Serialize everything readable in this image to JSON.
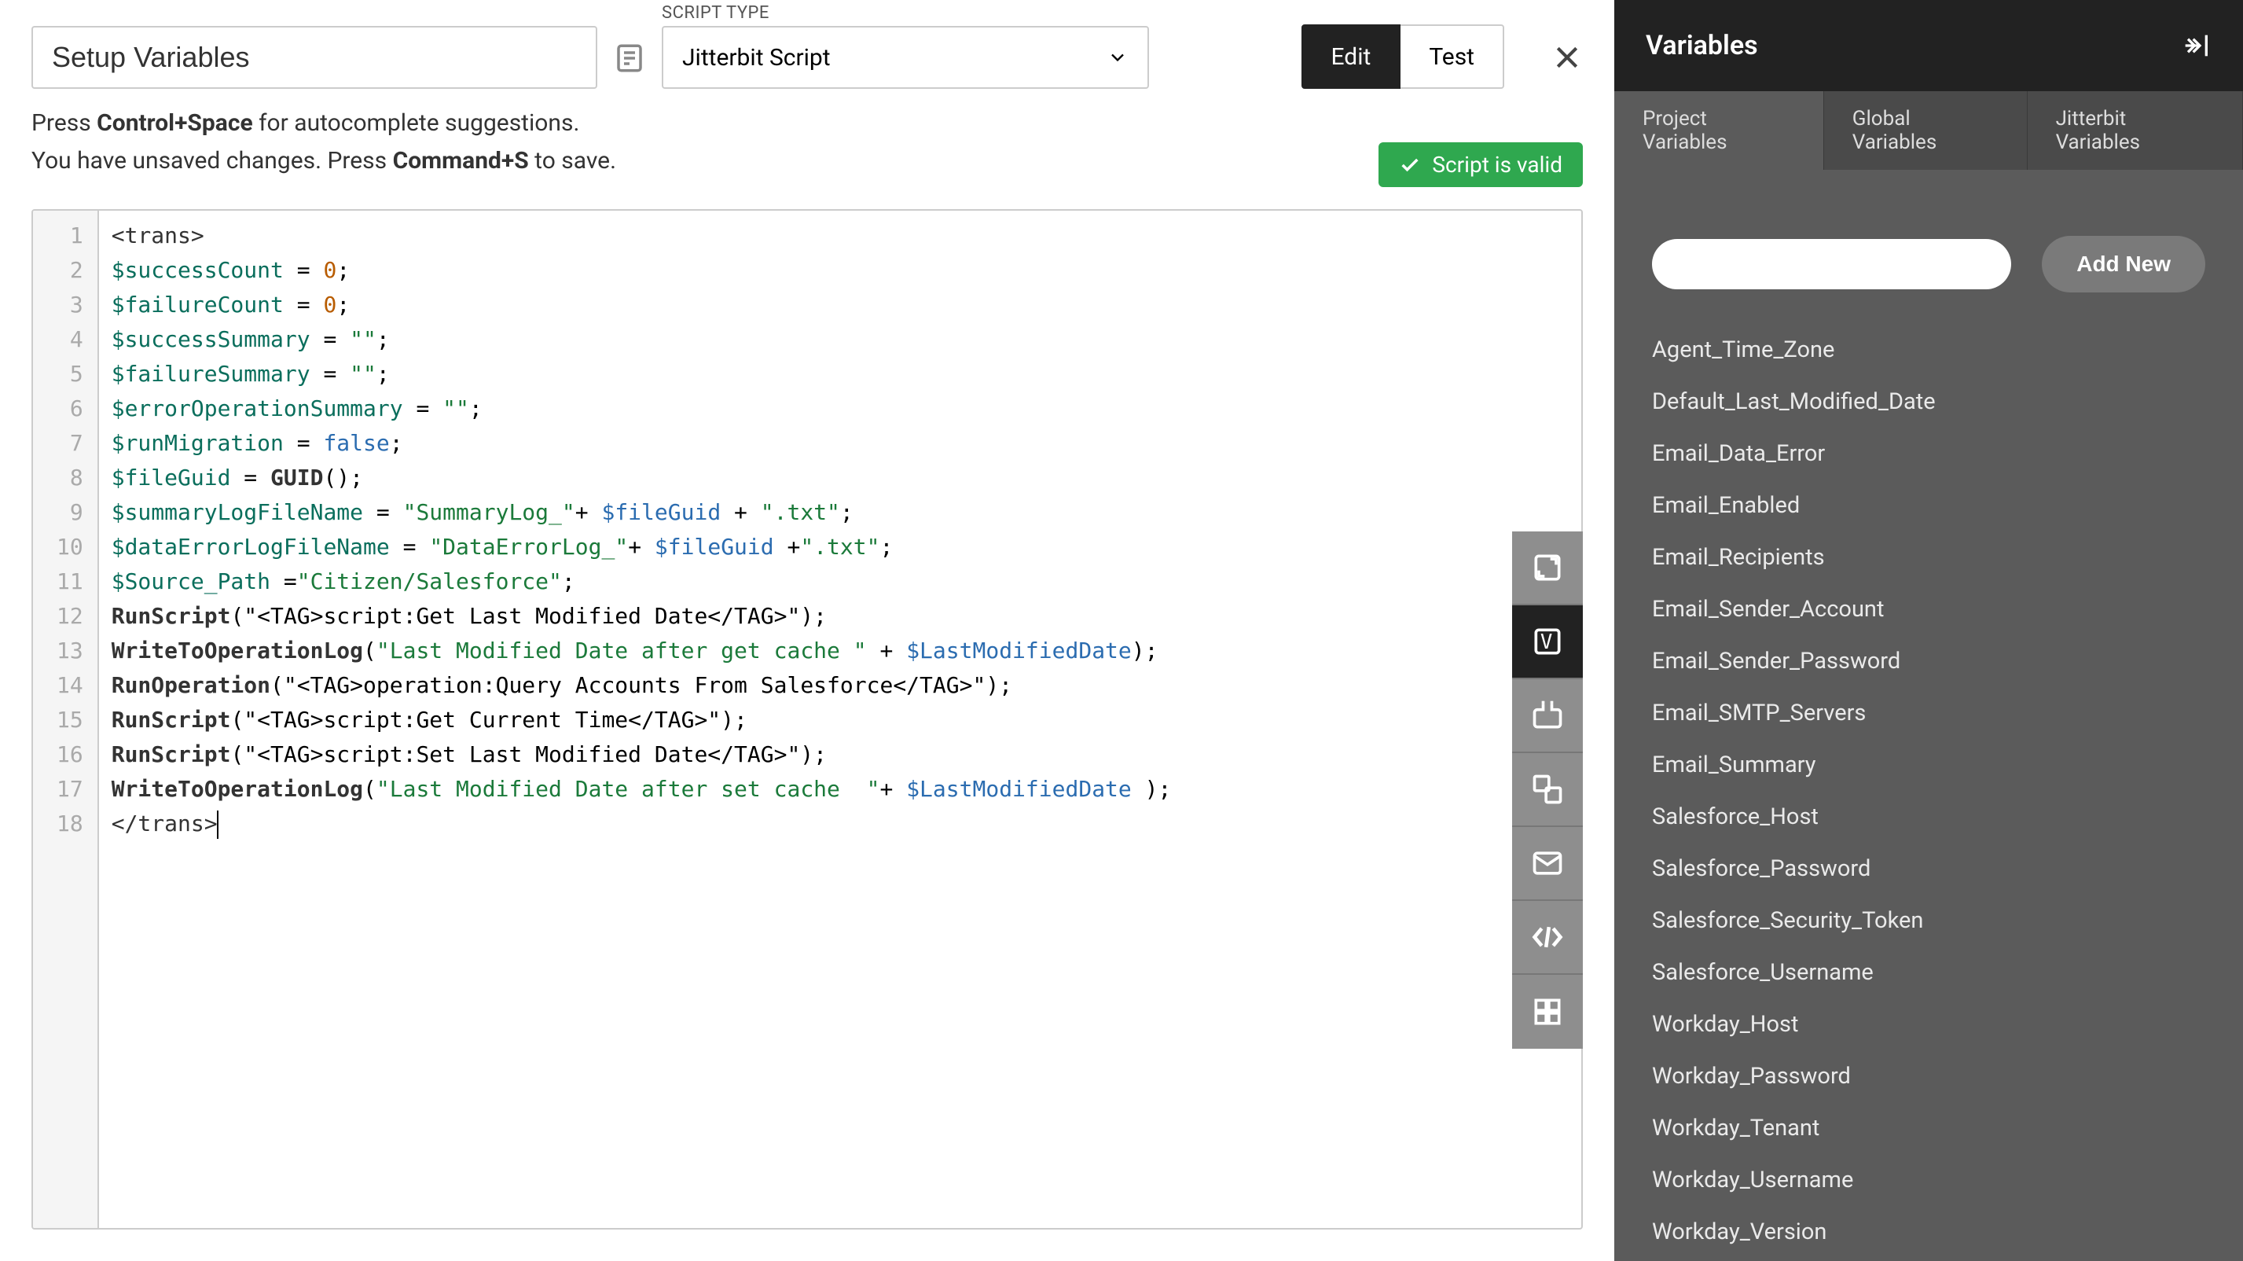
{
  "scriptName": "Setup Variables",
  "scriptTypeLabel": "SCRIPT TYPE",
  "scriptType": "Jitterbit Script",
  "editBtn": "Edit",
  "testBtn": "Test",
  "hint1_prefix": "Press ",
  "hint1_key": "Control+Space",
  "hint1_suffix": " for autocomplete suggestions.",
  "hint2_prefix": "You have unsaved changes. Press ",
  "hint2_key": "Command+S",
  "hint2_suffix": " to save.",
  "validBadge": "Script is valid",
  "code": {
    "lines": [
      "<trans>",
      "$successCount = 0;",
      "$failureCount = 0;",
      "$successSummary = \"\";",
      "$failureSummary = \"\";",
      "$errorOperationSummary = \"\";",
      "$runMigration = false;",
      "$fileGuid = GUID();",
      "$summaryLogFileName = \"SummaryLog_\"+ $fileGuid + \".txt\";",
      "$dataErrorLogFileName = \"DataErrorLog_\"+ $fileGuid +\".txt\";",
      "$Source_Path =\"Citizen/Salesforce\";",
      "RunScript(\"<TAG>script:Get Last Modified Date</TAG>\");",
      "WriteToOperationLog(\"Last Modified Date after get cache \" + $LastModifiedDate);",
      "RunOperation(\"<TAG>operation:Query Accounts From Salesforce</TAG>\");",
      "RunScript(\"<TAG>script:Get Current Time</TAG>\");",
      "RunScript(\"<TAG>script:Set Last Modified Date</TAG>\");",
      "WriteToOperationLog(\"Last Modified Date after set cache  \"+ $LastModifiedDate );",
      "</trans>"
    ]
  },
  "panel": {
    "title": "Variables",
    "tabs": [
      "Project Variables",
      "Global Variables",
      "Jitterbit Variables"
    ],
    "activeTab": 0,
    "addNew": "Add New",
    "items": [
      "Agent_Time_Zone",
      "Default_Last_Modified_Date",
      "Email_Data_Error",
      "Email_Enabled",
      "Email_Recipients",
      "Email_Sender_Account",
      "Email_Sender_Password",
      "Email_SMTP_Servers",
      "Email_Summary",
      "Salesforce_Host",
      "Salesforce_Password",
      "Salesforce_Security_Token",
      "Salesforce_Username",
      "Workday_Host",
      "Workday_Password",
      "Workday_Tenant",
      "Workday_Username",
      "Workday_Version"
    ]
  }
}
